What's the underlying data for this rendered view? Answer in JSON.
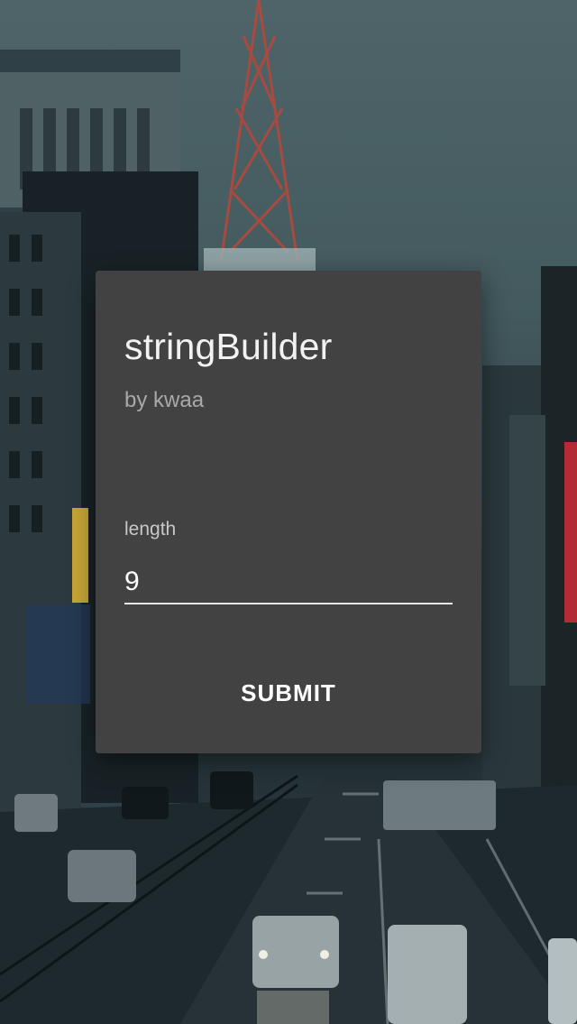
{
  "app": {
    "title": "stringBuilder",
    "author": "by kwaa"
  },
  "form": {
    "length_label": "length",
    "length_value": "9",
    "submit_label": "SUBMIT"
  },
  "colors": {
    "card": "#424242",
    "text": "#ffffff",
    "muted": "#a9a9a9"
  },
  "background": {
    "description_icon": "city-street-photo"
  }
}
